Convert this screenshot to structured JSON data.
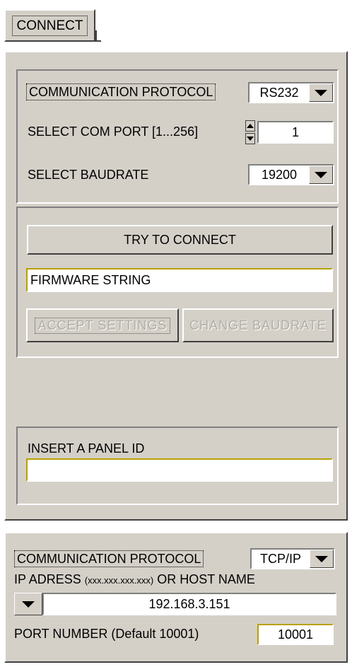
{
  "connect_button": {
    "label": "CONNECT"
  },
  "serial_panel": {
    "protocol_label": "COMMUNICATION PROTOCOL",
    "protocol_value": "RS232",
    "com_port_label": "SELECT COM PORT [1...256]",
    "com_port_value": "1",
    "baudrate_label": "SELECT BAUDRATE",
    "baudrate_value": "19200"
  },
  "connect_panel": {
    "try_connect_label": "TRY TO CONNECT",
    "firmware_value": "FIRMWARE STRING",
    "accept_settings_label": "ACCEPT SETTINGS",
    "change_baudrate_label": "CHANGE BAUDRATE"
  },
  "panel_id": {
    "label": "INSERT A PANEL ID",
    "value": ""
  },
  "tcp_panel": {
    "protocol_label": "COMMUNICATION PROTOCOL",
    "protocol_value": "TCP/IP",
    "ip_label_main": "IP ADRESS",
    "ip_label_format": "(xxx.xxx.xxx.xxx)",
    "ip_label_suffix": "OR HOST NAME",
    "ip_value": "192.168.3.151",
    "port_label": "PORT NUMBER (Default 10001)",
    "port_value": "10001"
  }
}
